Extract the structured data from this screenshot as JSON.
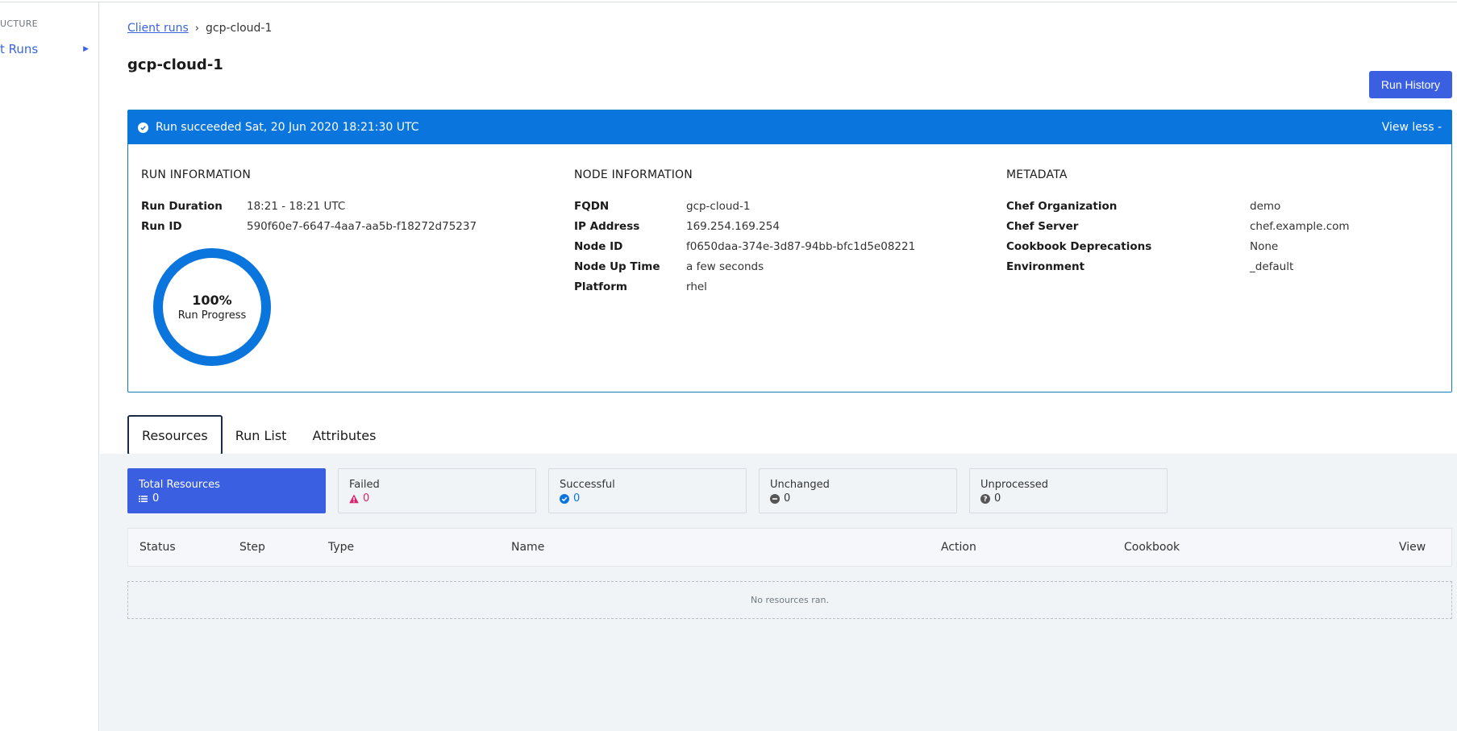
{
  "sidebar": {
    "heading": "UCTURE",
    "item_label": "t Runs"
  },
  "breadcrumb": {
    "parent": "Client runs",
    "current": "gcp-cloud-1"
  },
  "page_title": "gcp-cloud-1",
  "run_history_button": "Run History",
  "banner": {
    "status_text": "Run succeeded Sat, 20 Jun 2020 18:21:30 UTC",
    "toggle_label": "View less -",
    "color": "#0b75de"
  },
  "run_info": {
    "heading": "RUN INFORMATION",
    "rows": [
      {
        "key": "Run Duration",
        "value": "18:21 - 18:21 UTC"
      },
      {
        "key": "Run ID",
        "value": "590f60e7-6647-4aa7-aa5b-f18272d75237"
      }
    ],
    "progress": {
      "percent_label": "100%",
      "label": "Run Progress",
      "value": 1.0
    }
  },
  "node_info": {
    "heading": "NODE INFORMATION",
    "rows": [
      {
        "key": "FQDN",
        "value": "gcp-cloud-1"
      },
      {
        "key": "IP Address",
        "value": "169.254.169.254"
      },
      {
        "key": "Node ID",
        "value": "f0650daa-374e-3d87-94bb-bfc1d5e08221"
      },
      {
        "key": "Node Up Time",
        "value": "a few seconds"
      },
      {
        "key": "Platform",
        "value": "rhel"
      }
    ]
  },
  "metadata": {
    "heading": "METADATA",
    "rows": [
      {
        "key": "Chef Organization",
        "value": "demo"
      },
      {
        "key": "Chef Server",
        "value": "chef.example.com"
      },
      {
        "key": "Cookbook Deprecations",
        "value": "None"
      },
      {
        "key": "Environment",
        "value": "_default"
      }
    ]
  },
  "tabs": [
    {
      "label": "Resources",
      "active": true
    },
    {
      "label": "Run List",
      "active": false
    },
    {
      "label": "Attributes",
      "active": false
    }
  ],
  "stats": [
    {
      "label": "Total Resources",
      "value": "0",
      "icon": "list-icon",
      "color": "#ffffff"
    },
    {
      "label": "Failed",
      "value": "0",
      "icon": "warning-icon",
      "color": "#d6246e"
    },
    {
      "label": "Successful",
      "value": "0",
      "icon": "check-circle-icon",
      "color": "#0b75de"
    },
    {
      "label": "Unchanged",
      "value": "0",
      "icon": "minus-circle-icon",
      "color": "#555555"
    },
    {
      "label": "Unprocessed",
      "value": "0",
      "icon": "question-circle-icon",
      "color": "#555555"
    }
  ],
  "table": {
    "columns": [
      "Status",
      "Step",
      "Type",
      "Name",
      "Action",
      "Cookbook",
      "View"
    ],
    "empty_message": "No resources ran."
  }
}
